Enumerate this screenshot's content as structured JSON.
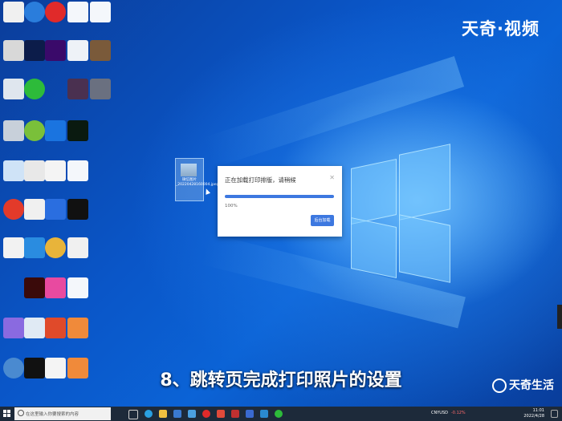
{
  "brand": {
    "top": "天奇·视频",
    "bottom": "天奇生活"
  },
  "caption": "8、跳转页完成打印照片的设置",
  "selected_file": {
    "label": "微信图片_20220428160004.jpeg"
  },
  "dialog": {
    "title": "正在加载打印排版，请稍候",
    "progress": 1.0,
    "percent_text": "100%",
    "button": "后台加载"
  },
  "taskbar": {
    "search_placeholder": "在这里输入你要搜索的内容",
    "ticker": "CNYUSD",
    "ticker_change": "-0.12%",
    "time": "11:01",
    "date": "2022/4/28"
  },
  "colors": {
    "accent": "#3d78e0",
    "taskbar": "#1d2a3a"
  }
}
